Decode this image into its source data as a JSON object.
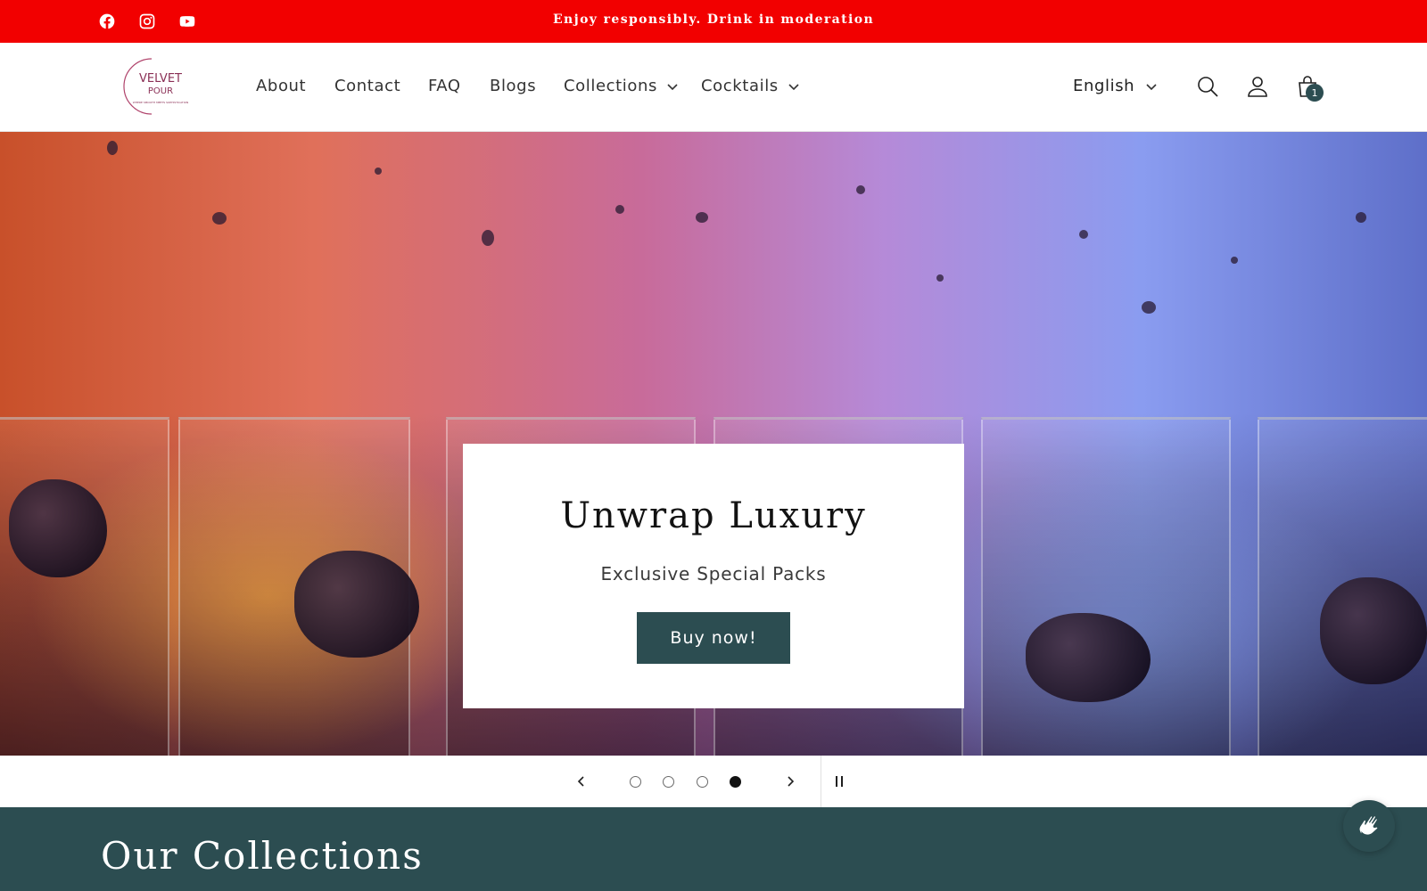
{
  "announcement": {
    "text": "Enjoy responsibly. Drink in moderation",
    "social_icons": [
      "facebook-icon",
      "instagram-icon",
      "youtube-icon"
    ],
    "background_color": "#f20000"
  },
  "header": {
    "logo": {
      "line1": "VELVET",
      "line2": "POUR",
      "tagline": "WHERE SMOOTH MEETS SOPHISTICATION"
    },
    "nav": [
      {
        "label": "About"
      },
      {
        "label": "Contact"
      },
      {
        "label": "FAQ"
      },
      {
        "label": "Blogs"
      },
      {
        "label": "Collections",
        "has_dropdown": true
      },
      {
        "label": "Cocktails",
        "has_dropdown": true
      }
    ],
    "language": "English",
    "icons": [
      "search-icon",
      "account-icon",
      "cart-icon"
    ],
    "cart_count": "1"
  },
  "hero": {
    "title": "Unwrap Luxury",
    "subtitle": "Exclusive Special Packs",
    "button_label": "Buy now!",
    "accent_color": "#2c4d51"
  },
  "slider": {
    "slide_count": 4,
    "active_slide": 4,
    "icons": [
      "chevron-left-icon",
      "chevron-right-icon",
      "pause-icon"
    ]
  },
  "collections": {
    "title": "Our Collections",
    "background_color": "#2c4d51"
  },
  "chat": {
    "icon": "waving-hand-icon"
  }
}
